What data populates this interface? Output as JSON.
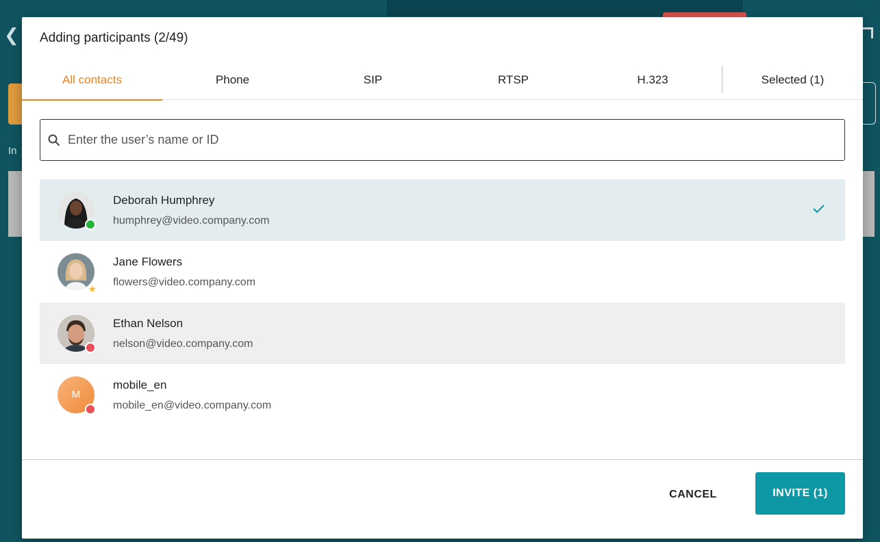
{
  "dialog": {
    "title": "Adding participants (2/49)"
  },
  "tabs": [
    {
      "label": "All contacts",
      "active": true
    },
    {
      "label": "Phone",
      "active": false
    },
    {
      "label": "SIP",
      "active": false
    },
    {
      "label": "RTSP",
      "active": false
    },
    {
      "label": "H.323",
      "active": false
    },
    {
      "label": "Selected (1)",
      "active": false
    }
  ],
  "search": {
    "placeholder": "Enter the user’s name or ID",
    "value": ""
  },
  "contacts": [
    {
      "name": "Deborah Humphrey",
      "email": "humphrey@video.company.com",
      "status": "online",
      "selected": true
    },
    {
      "name": "Jane Flowers",
      "email": "flowers@video.company.com",
      "status": "favorite",
      "selected": false
    },
    {
      "name": "Ethan Nelson",
      "email": "nelson@video.company.com",
      "status": "busy",
      "selected": false
    },
    {
      "name": "mobile_en",
      "email": "mobile_en@video.company.com",
      "status": "busy",
      "selected": false,
      "initial": "M"
    }
  ],
  "buttons": {
    "cancel": "CANCEL",
    "invite": "INVITE (1)"
  },
  "background": {
    "partial_label": "In"
  },
  "colors": {
    "accent_orange": "#f0831e",
    "primary_teal": "#0e97a4",
    "status_online": "#22b53a",
    "status_busy": "#e9505a",
    "status_favorite": "#f5b82e",
    "selected_row": "#e3ecef"
  }
}
